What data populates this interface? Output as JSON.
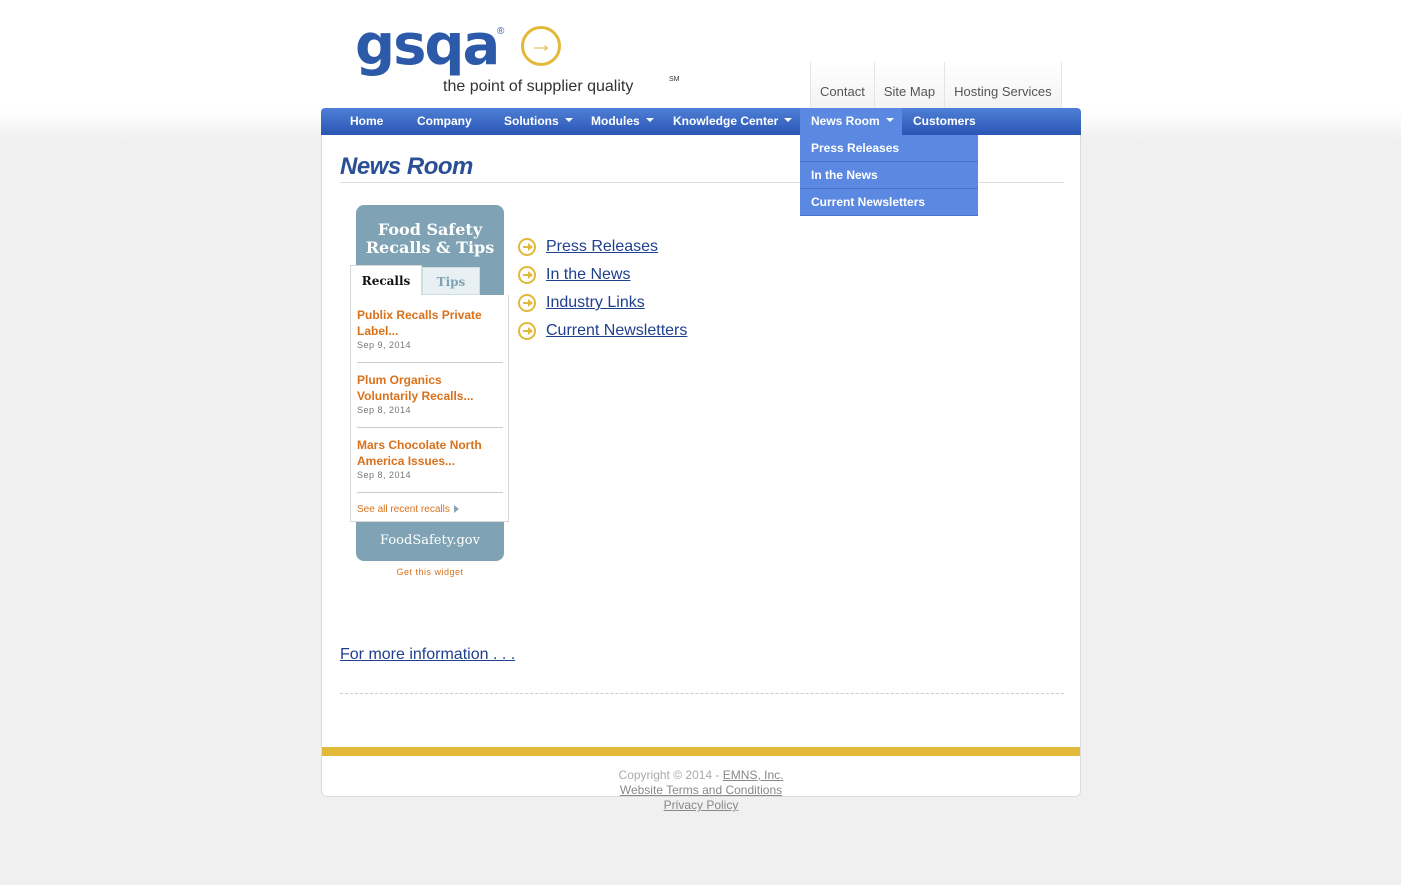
{
  "logo": {
    "brand": "gsqa",
    "registered": "®",
    "tagline": "the point of supplier quality",
    "service_mark": "SM",
    "arrow": "→"
  },
  "top_links": [
    "Contact",
    "Site Map",
    "Hosting Services"
  ],
  "nav": {
    "items": [
      "Home",
      "Company",
      "Solutions",
      "Modules",
      "Knowledge Center",
      "News Room",
      "Customers"
    ],
    "active": "News Room",
    "dropdown": [
      "Press Releases",
      "In the News",
      "Current Newsletters"
    ]
  },
  "page": {
    "title": "News Room",
    "links": [
      "Press Releases",
      "In the News",
      "Industry Links",
      "Current Newsletters"
    ],
    "more_info": "For more information . . ."
  },
  "widget": {
    "title_line1": "Food Safety",
    "title_line2": "Recalls & Tips",
    "tab_active": "Recalls",
    "tab_other": "Tips",
    "items": [
      {
        "title": "Publix Recalls Private Label...",
        "date": "Sep 9, 2014"
      },
      {
        "title": "Plum Organics Voluntarily Recalls...",
        "date": "Sep 8, 2014"
      },
      {
        "title": "Mars Chocolate North America Issues...",
        "date": "Sep 8, 2014"
      }
    ],
    "see_all": "See all recent recalls",
    "footer": "FoodSafety.gov",
    "get_widget": "Get this widget"
  },
  "footer": {
    "copyright": "Copyright © 2014 -",
    "company": "EMNS, Inc.",
    "terms": "Website Terms and Conditions",
    "privacy": "Privacy Policy"
  },
  "colors": {
    "brand_blue": "#2c5aa8",
    "gold": "#e2b93b",
    "nav_active": "#5b88e0",
    "widget_teal": "#7fa3b4",
    "recall_orange": "#d9711a"
  }
}
